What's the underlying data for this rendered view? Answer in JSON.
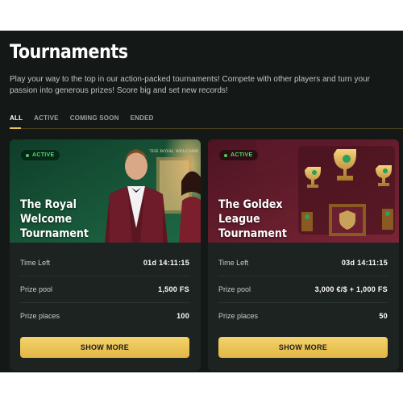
{
  "page": {
    "title": "Tournaments",
    "description": "Play your way to the top in our action-packed tournaments! Compete with other players and turn your passion into generous prizes! Score big and set new records!"
  },
  "tabs": [
    {
      "label": "ALL",
      "active": true
    },
    {
      "label": "ACTIVE",
      "active": false
    },
    {
      "label": "COMING SOON",
      "active": false
    },
    {
      "label": "ENDED",
      "active": false
    }
  ],
  "tournaments": [
    {
      "status": "ACTIVE",
      "title": "The Royal Welcome Tournament",
      "banner_sign": "THE ROYAL WELCOME",
      "time_left_label": "Time Left",
      "time_left_value": "01d 14:11:15",
      "prize_pool_label": "Prize pool",
      "prize_pool_value": "1,500 FS",
      "prize_places_label": "Prize places",
      "prize_places_value": "100",
      "button_label": "SHOW MORE",
      "banner_color": "#1d5a3c"
    },
    {
      "status": "ACTIVE",
      "title": "The Goldex League Tournament",
      "time_left_label": "Time Left",
      "time_left_value": "03d 14:11:15",
      "prize_pool_label": "Prize pool",
      "prize_pool_value": "3,000 €/$ + 1,000 FS",
      "prize_places_label": "Prize places",
      "prize_places_value": "50",
      "button_label": "SHOW MORE",
      "banner_color": "#6a1f2e"
    }
  ],
  "colors": {
    "background": "#141918",
    "card": "#1d2321",
    "accent": "#e9c45c",
    "status_active": "#47e06a"
  }
}
